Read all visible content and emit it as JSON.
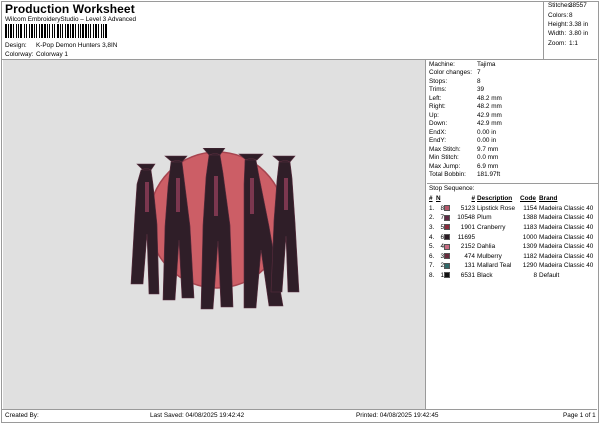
{
  "header": {
    "title": "Production Worksheet",
    "subtitle": "Wilcom EmbroideryStudio – Level 3 Advanced",
    "design_label": "Design:",
    "design_value": "K-Pop Demon Hunters 3,8IN",
    "colorway_label": "Colorway:",
    "colorway_value": "Colorway 1"
  },
  "summary": [
    {
      "k": "Stitches:",
      "v": "38557"
    },
    {
      "k": "Colors:",
      "v": "8"
    },
    {
      "k": "Height:",
      "v": "3.38 in"
    },
    {
      "k": "Width:",
      "v": "3.80 in"
    },
    {
      "k": "Zoom:",
      "v": "1:1"
    }
  ],
  "info": [
    {
      "k": "Machine:",
      "v": "Tajima"
    },
    {
      "k": "Color changes:",
      "v": "7"
    },
    {
      "k": "Stops:",
      "v": "8"
    },
    {
      "k": "Trims:",
      "v": "39"
    },
    {
      "k": "Left:",
      "v": "48.2 mm"
    },
    {
      "k": "Right:",
      "v": "48.2 mm"
    },
    {
      "k": "Up:",
      "v": "42.9 mm"
    },
    {
      "k": "Down:",
      "v": "42.9 mm"
    },
    {
      "k": "EndX:",
      "v": "0.00 in"
    },
    {
      "k": "EndY:",
      "v": "0.00 in"
    },
    {
      "k": "Max Stitch:",
      "v": "9.7 mm"
    },
    {
      "k": "Min Stitch:",
      "v": "0.0 mm"
    },
    {
      "k": "Max Jump:",
      "v": "6.9 mm"
    },
    {
      "k": "Total Bobbin:",
      "v": "181.97ft"
    }
  ],
  "stop_sequence": {
    "title": "Stop Sequence:",
    "headers": {
      "num": "#",
      "n": "N",
      "stitches": "#",
      "description": "Description",
      "code": "Code",
      "brand": "Brand"
    },
    "rows": [
      {
        "num": "1.",
        "n": "8",
        "color": "#b5576a",
        "stitches": "5123",
        "description": "Lipstick Rose",
        "code": "1154",
        "brand": "Madeira Classic 40"
      },
      {
        "num": "2.",
        "n": "7",
        "color": "#5e2b45",
        "stitches": "10548",
        "description": "Plum",
        "code": "1388",
        "brand": "Madeira Classic 40"
      },
      {
        "num": "3.",
        "n": "5",
        "color": "#8b2b3c",
        "stitches": "1901",
        "description": "Cranberry",
        "code": "1183",
        "brand": "Madeira Classic 40"
      },
      {
        "num": "4.",
        "n": "6",
        "color": "#2a1a24",
        "stitches": "11695",
        "description": "",
        "code": "1000",
        "brand": "Madeira Classic 40"
      },
      {
        "num": "5.",
        "n": "4",
        "color": "#c96b82",
        "stitches": "2152",
        "description": "Dahlia",
        "code": "1309",
        "brand": "Madeira Classic 40"
      },
      {
        "num": "6.",
        "n": "3",
        "color": "#6a2a3b",
        "stitches": "474",
        "description": "Mulberry",
        "code": "1182",
        "brand": "Madeira Classic 40"
      },
      {
        "num": "7.",
        "n": "2",
        "color": "#2d6a6a",
        "stitches": "131",
        "description": "Mallard Teal",
        "code": "1290",
        "brand": "Madeira Classic 40"
      },
      {
        "num": "8.",
        "n": "1",
        "color": "#111111",
        "stitches": "6531",
        "description": "Black",
        "code": "8",
        "brand": "Default"
      }
    ]
  },
  "footer": {
    "created": "Created By:",
    "saved": "Last Saved: 04/08/2025 19:42:42",
    "printed": "Printed: 04/08/2025 19:42:45",
    "page": "Page 1 of 1"
  },
  "colors": {
    "canvas": "#e0e0e0",
    "moon": "#cc5e66",
    "figures": "#2f1e28",
    "accent": "#8a3c56"
  }
}
